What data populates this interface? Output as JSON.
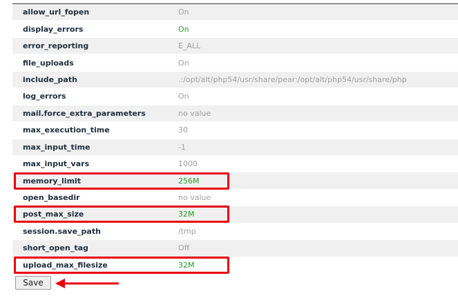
{
  "settings": [
    {
      "name": "allow_url_fopen",
      "value": "On",
      "enabled": false
    },
    {
      "name": "display_errors",
      "value": "On",
      "enabled": true
    },
    {
      "name": "error_reporting",
      "value": "E_ALL",
      "enabled": false
    },
    {
      "name": "file_uploads",
      "value": "On",
      "enabled": false
    },
    {
      "name": "include_path",
      "value": ".:/opt/alt/php54/usr/share/pear:/opt/alt/php54/usr/share/php",
      "enabled": false
    },
    {
      "name": "log_errors",
      "value": "On",
      "enabled": false
    },
    {
      "name": "mail.force_extra_parameters",
      "value": "no value",
      "enabled": false
    },
    {
      "name": "max_execution_time",
      "value": "30",
      "enabled": false
    },
    {
      "name": "max_input_time",
      "value": "-1",
      "enabled": false
    },
    {
      "name": "max_input_vars",
      "value": "1000",
      "enabled": false
    },
    {
      "name": "memory_limit",
      "value": "256M",
      "enabled": true
    },
    {
      "name": "open_basedir",
      "value": "no value",
      "enabled": false
    },
    {
      "name": "post_max_size",
      "value": "32M",
      "enabled": true
    },
    {
      "name": "session.save_path",
      "value": "/tmp",
      "enabled": false
    },
    {
      "name": "short_open_tag",
      "value": "Off",
      "enabled": false
    },
    {
      "name": "upload_max_filesize",
      "value": "32M",
      "enabled": true
    }
  ],
  "save_label": "Save",
  "colors": {
    "highlight": "#e8000b",
    "enabled_value": "#2c9a2c",
    "default_value": "#a0a0a0"
  }
}
